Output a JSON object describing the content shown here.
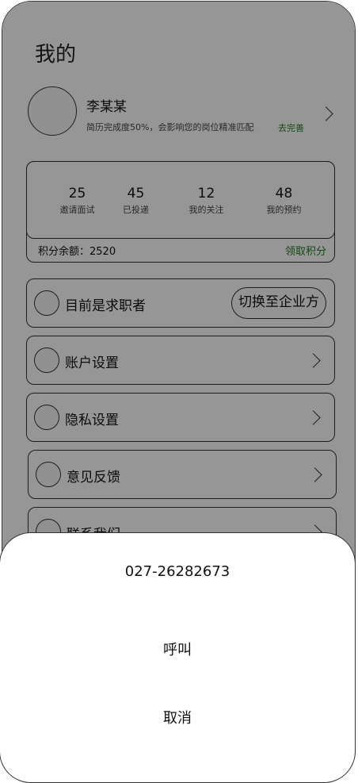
{
  "page": {
    "title": "我的"
  },
  "profile": {
    "name": "李某某",
    "completion_text": "简历完成度50%，会影响您的岗位精准匹配",
    "complete_link": "去完善"
  },
  "stats": [
    {
      "value": "25",
      "label": "邀请面试"
    },
    {
      "value": "45",
      "label": "已投递"
    },
    {
      "value": "12",
      "label": "我的关注"
    },
    {
      "value": "48",
      "label": "我的预约"
    }
  ],
  "points": {
    "label": "积分余额：2520",
    "claim_link": "领取积分"
  },
  "menu": {
    "role_label": "目前是求职者",
    "switch_button": "切换至企业方",
    "items": [
      {
        "label": "账户设置"
      },
      {
        "label": "隐私设置"
      },
      {
        "label": "意见反馈"
      },
      {
        "label": "联系我们"
      }
    ]
  },
  "sheet": {
    "phone_number": "027-26282673",
    "call_button": "呼叫",
    "cancel_button": "取消"
  },
  "colors": {
    "link_green": "#1f7a1f",
    "overlay": "#000000"
  }
}
